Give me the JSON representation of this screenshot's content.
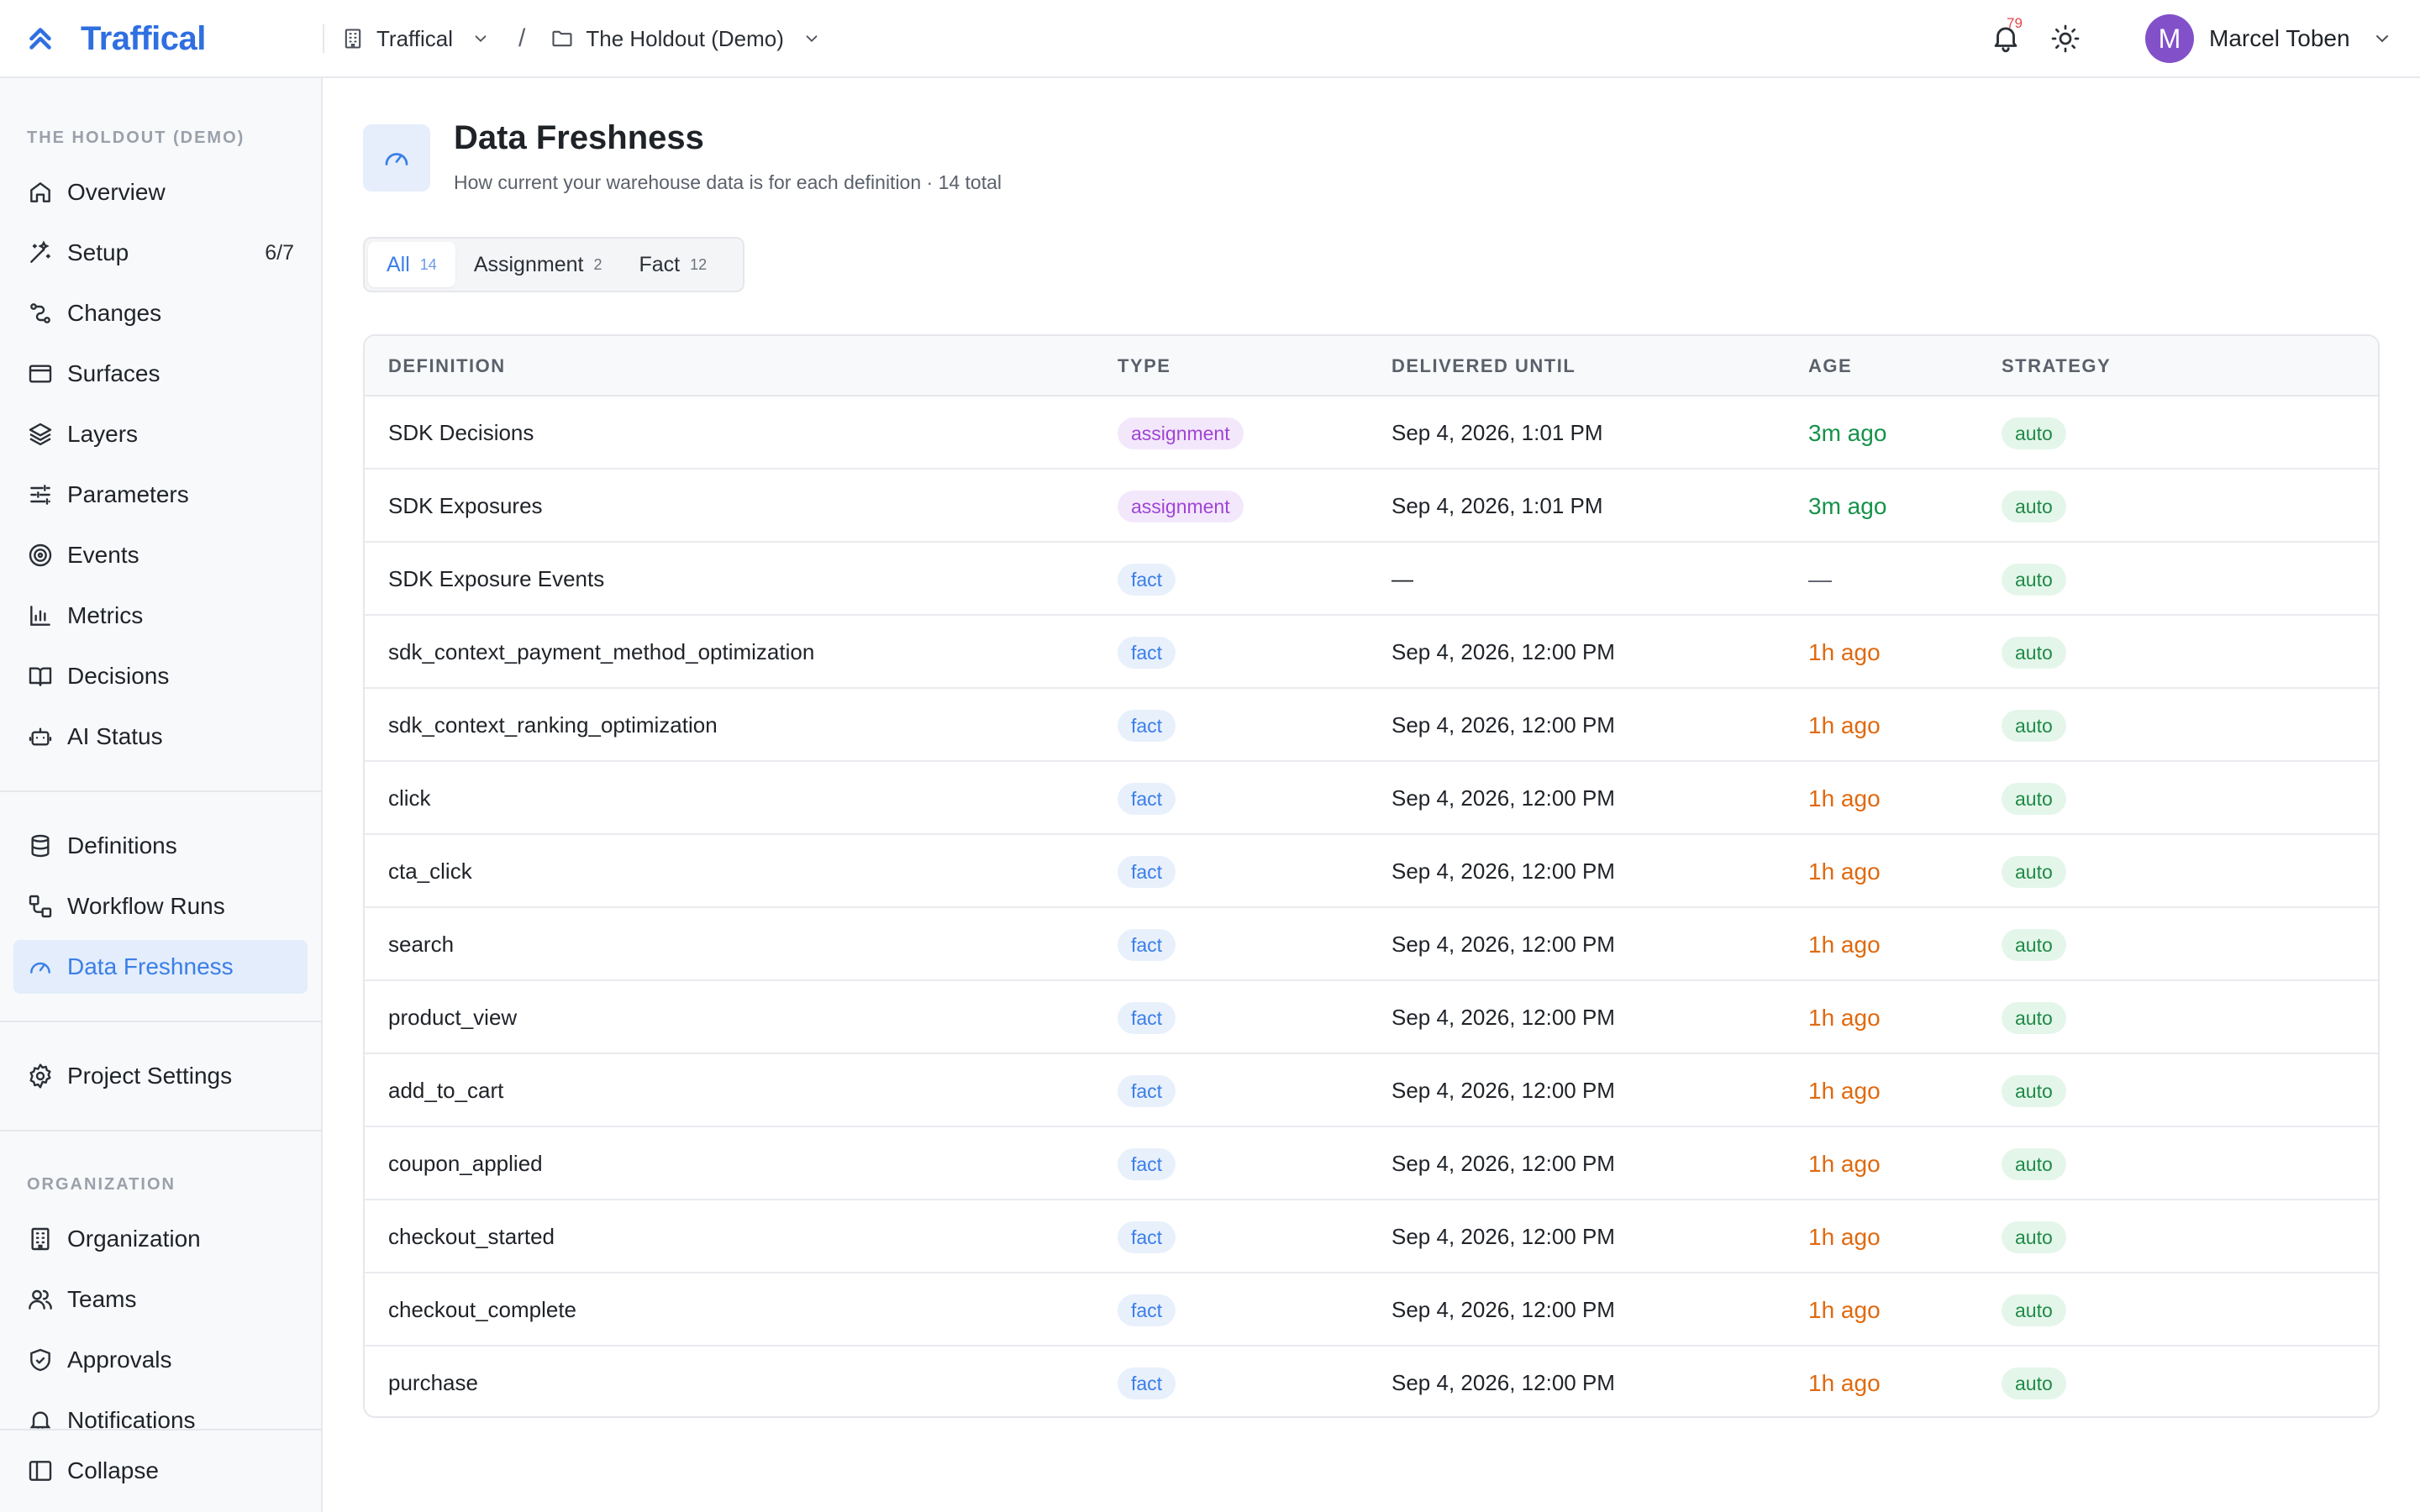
{
  "app": {
    "name": "Traffical"
  },
  "breadcrumb": [
    {
      "label": "Traffical",
      "icon": "building-icon"
    },
    {
      "label": "The Holdout (Demo)",
      "icon": "folder-icon"
    }
  ],
  "breadcrumb_separator": "/",
  "header": {
    "notifications_count": "79",
    "user_initial": "M",
    "user_name": "Marcel Toben"
  },
  "sidebar": {
    "project_heading": "THE HOLDOUT (DEMO)",
    "project_items": [
      {
        "label": "Overview",
        "icon": "home-icon"
      },
      {
        "label": "Setup",
        "icon": "wand-icon",
        "count": "6/7"
      },
      {
        "label": "Changes",
        "icon": "changes-icon"
      },
      {
        "label": "Surfaces",
        "icon": "browser-icon"
      },
      {
        "label": "Layers",
        "icon": "layers-icon"
      },
      {
        "label": "Parameters",
        "icon": "sliders-icon"
      },
      {
        "label": "Events",
        "icon": "target-icon"
      },
      {
        "label": "Metrics",
        "icon": "bar-chart-icon"
      },
      {
        "label": "Decisions",
        "icon": "book-icon"
      },
      {
        "label": "AI Status",
        "icon": "bot-icon"
      }
    ],
    "data_items": [
      {
        "label": "Definitions",
        "icon": "database-icon"
      },
      {
        "label": "Workflow Runs",
        "icon": "workflow-icon"
      },
      {
        "label": "Data Freshness",
        "icon": "gauge-icon",
        "active": true
      }
    ],
    "settings_items": [
      {
        "label": "Project Settings",
        "icon": "gear-icon"
      }
    ],
    "org_heading": "ORGANIZATION",
    "org_items": [
      {
        "label": "Organization",
        "icon": "building-icon"
      },
      {
        "label": "Teams",
        "icon": "users-icon"
      },
      {
        "label": "Approvals",
        "icon": "shield-check-icon"
      },
      {
        "label": "Notifications",
        "icon": "bell-icon"
      }
    ],
    "collapse_label": "Collapse"
  },
  "page": {
    "title": "Data Freshness",
    "subtitle": "How current your warehouse data is for each definition · 14 total"
  },
  "filters": [
    {
      "label": "All",
      "count": "14",
      "active": true
    },
    {
      "label": "Assignment",
      "count": "2"
    },
    {
      "label": "Fact",
      "count": "12"
    }
  ],
  "table": {
    "columns": [
      "DEFINITION",
      "TYPE",
      "DELIVERED UNTIL",
      "AGE",
      "STRATEGY"
    ],
    "rows": [
      {
        "definition": "SDK Decisions",
        "type": "assignment",
        "delivered_until": "Sep 4, 2026, 1:01 PM",
        "age": "3m ago",
        "age_status": "fresh",
        "strategy": "auto"
      },
      {
        "definition": "SDK Exposures",
        "type": "assignment",
        "delivered_until": "Sep 4, 2026, 1:01 PM",
        "age": "3m ago",
        "age_status": "fresh",
        "strategy": "auto"
      },
      {
        "definition": "SDK Exposure Events",
        "type": "fact",
        "delivered_until": "—",
        "age": "—",
        "age_status": "none",
        "strategy": "auto"
      },
      {
        "definition": "sdk_context_payment_method_optimization",
        "type": "fact",
        "delivered_until": "Sep 4, 2026, 12:00 PM",
        "age": "1h ago",
        "age_status": "stale",
        "strategy": "auto"
      },
      {
        "definition": "sdk_context_ranking_optimization",
        "type": "fact",
        "delivered_until": "Sep 4, 2026, 12:00 PM",
        "age": "1h ago",
        "age_status": "stale",
        "strategy": "auto"
      },
      {
        "definition": "click",
        "type": "fact",
        "delivered_until": "Sep 4, 2026, 12:00 PM",
        "age": "1h ago",
        "age_status": "stale",
        "strategy": "auto"
      },
      {
        "definition": "cta_click",
        "type": "fact",
        "delivered_until": "Sep 4, 2026, 12:00 PM",
        "age": "1h ago",
        "age_status": "stale",
        "strategy": "auto"
      },
      {
        "definition": "search",
        "type": "fact",
        "delivered_until": "Sep 4, 2026, 12:00 PM",
        "age": "1h ago",
        "age_status": "stale",
        "strategy": "auto"
      },
      {
        "definition": "product_view",
        "type": "fact",
        "delivered_until": "Sep 4, 2026, 12:00 PM",
        "age": "1h ago",
        "age_status": "stale",
        "strategy": "auto"
      },
      {
        "definition": "add_to_cart",
        "type": "fact",
        "delivered_until": "Sep 4, 2026, 12:00 PM",
        "age": "1h ago",
        "age_status": "stale",
        "strategy": "auto"
      },
      {
        "definition": "coupon_applied",
        "type": "fact",
        "delivered_until": "Sep 4, 2026, 12:00 PM",
        "age": "1h ago",
        "age_status": "stale",
        "strategy": "auto"
      },
      {
        "definition": "checkout_started",
        "type": "fact",
        "delivered_until": "Sep 4, 2026, 12:00 PM",
        "age": "1h ago",
        "age_status": "stale",
        "strategy": "auto"
      },
      {
        "definition": "checkout_complete",
        "type": "fact",
        "delivered_until": "Sep 4, 2026, 12:00 PM",
        "age": "1h ago",
        "age_status": "stale",
        "strategy": "auto"
      },
      {
        "definition": "purchase",
        "type": "fact",
        "delivered_until": "Sep 4, 2026, 12:00 PM",
        "age": "1h ago",
        "age_status": "stale",
        "strategy": "auto"
      }
    ]
  },
  "colors": {
    "brand": "#2f6fe0",
    "active_nav_bg": "#e3edfc",
    "active_nav_text": "#3b7ee8",
    "age_fresh": "#15924a",
    "age_stale": "#e0690f",
    "assignment_pill": "#a044d6",
    "fact_pill": "#3b7ee8",
    "auto_pill": "#1f8a47",
    "avatar": "#8251c9",
    "badge": "#e5484d"
  }
}
